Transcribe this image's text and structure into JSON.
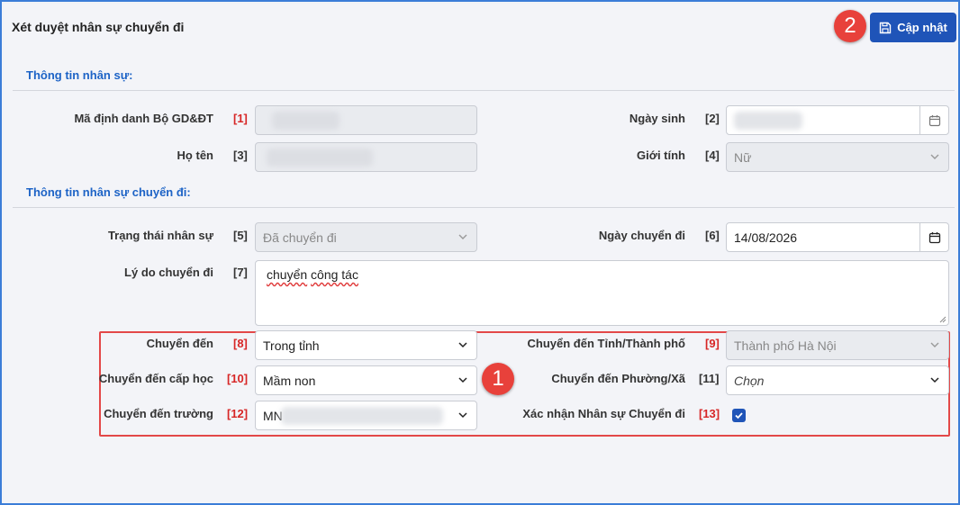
{
  "page": {
    "title": "Xét duyệt nhân sự chuyển đi",
    "update_button": "Cập nhật",
    "badge_1": "1",
    "badge_2": "2"
  },
  "section_personal": {
    "title": "Thông tin nhân sự:",
    "fields": {
      "ma_dinh_danh": {
        "label": "Mã định danh Bộ GD&ĐT",
        "num": "[1]"
      },
      "ngay_sinh": {
        "label": "Ngày sinh",
        "num": "[2]"
      },
      "ho_ten": {
        "label": "Họ tên",
        "num": "[3]"
      },
      "gioi_tinh": {
        "label": "Giới tính",
        "num": "[4]",
        "value": "Nữ"
      }
    }
  },
  "section_transfer": {
    "title": "Thông tin nhân sự chuyển đi:",
    "fields": {
      "trang_thai": {
        "label": "Trạng thái nhân sự",
        "num": "[5]",
        "value": "Đã chuyển đi"
      },
      "ngay_chuyen_di": {
        "label": "Ngày chuyển đi",
        "num": "[6]",
        "value": "14/08/2026"
      },
      "ly_do": {
        "label": "Lý do chuyển đi",
        "num": "[7]",
        "value_a": "chuyển",
        "value_b": "công tác"
      },
      "chuyen_den": {
        "label": "Chuyển đến",
        "num": "[8]",
        "value": "Trong tỉnh"
      },
      "tinh_thanh_pho": {
        "label": "Chuyển đến Tỉnh/Thành phố",
        "num": "[9]",
        "value": "Thành phố Hà Nội"
      },
      "cap_hoc": {
        "label": "Chuyển đến cấp học",
        "num": "[10]",
        "value": "Mầm non"
      },
      "phuong_xa": {
        "label": "Chuyển đến Phường/Xã",
        "num": "[11]",
        "placeholder": "Chọn"
      },
      "truong": {
        "label": "Chuyển đến trường",
        "num": "[12]",
        "value": "MN"
      },
      "xac_nhan": {
        "label": "Xác nhận Nhân sự Chuyển đi",
        "num": "[13]",
        "checked": true
      }
    }
  },
  "colors": {
    "accent": "#1f54b8",
    "section_title": "#1d63c6",
    "required_num": "#d72626",
    "badge": "#e8413b"
  }
}
